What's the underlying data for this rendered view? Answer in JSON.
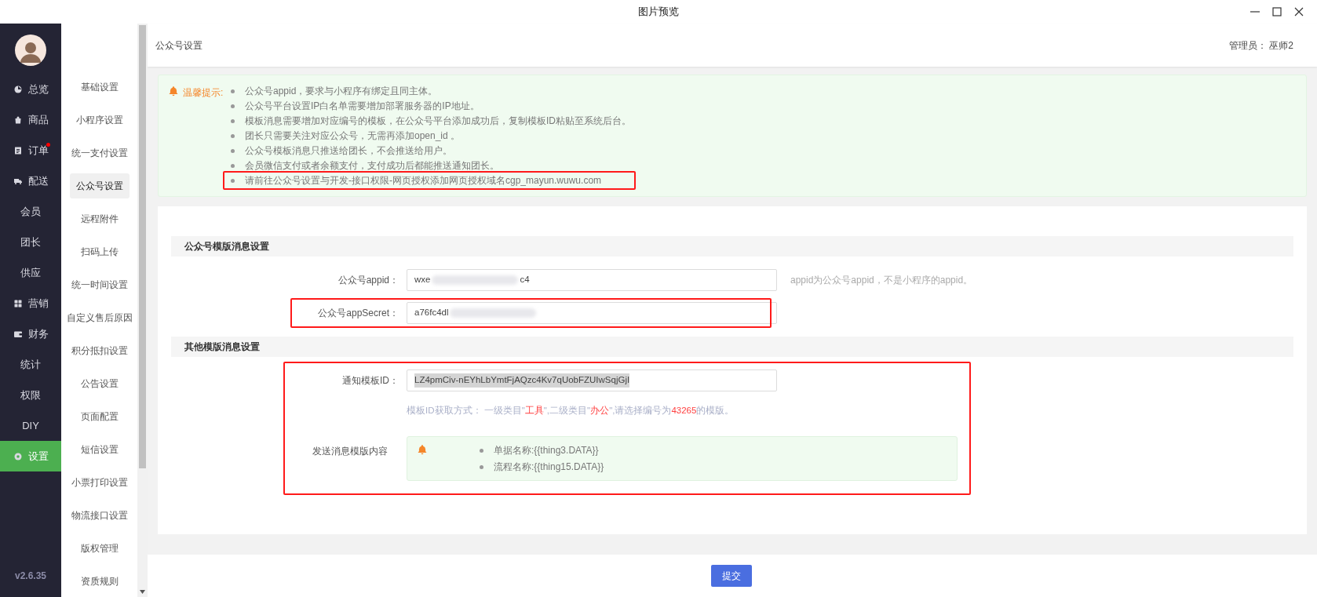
{
  "window": {
    "title": "图片预览"
  },
  "main_nav": {
    "version": "v2.6.35",
    "items": [
      {
        "label": "总览",
        "kind": "icon",
        "selected": false,
        "badge_dot": false
      },
      {
        "label": "商品",
        "kind": "icon",
        "selected": false,
        "badge_dot": false
      },
      {
        "label": "订单",
        "kind": "icon",
        "selected": false,
        "badge_dot": true
      },
      {
        "label": "配送",
        "kind": "icon",
        "selected": false,
        "badge_dot": false
      },
      {
        "label": "会员",
        "kind": "text",
        "selected": false,
        "badge_dot": false
      },
      {
        "label": "团长",
        "kind": "text",
        "selected": false,
        "badge_dot": false
      },
      {
        "label": "供应",
        "kind": "text",
        "selected": false,
        "badge_dot": false
      },
      {
        "label": "营销",
        "kind": "icon",
        "selected": false,
        "badge_dot": false
      },
      {
        "label": "财务",
        "kind": "icon",
        "selected": false,
        "badge_dot": false
      },
      {
        "label": "统计",
        "kind": "text",
        "selected": false,
        "badge_dot": false
      },
      {
        "label": "权限",
        "kind": "text",
        "selected": false,
        "badge_dot": false
      },
      {
        "label": "DIY",
        "kind": "text",
        "selected": false,
        "badge_dot": false
      },
      {
        "label": "设置",
        "kind": "icon",
        "selected": true,
        "badge_dot": false
      }
    ]
  },
  "sub_nav": {
    "items": [
      {
        "label": "基础设置",
        "selected": false
      },
      {
        "label": "小程序设置",
        "selected": false
      },
      {
        "label": "统一支付设置",
        "selected": false
      },
      {
        "label": "公众号设置",
        "selected": true
      },
      {
        "label": "远程附件",
        "selected": false
      },
      {
        "label": "扫码上传",
        "selected": false
      },
      {
        "label": "统一时间设置",
        "selected": false
      },
      {
        "label": "自定义售后原因",
        "selected": false
      },
      {
        "label": "积分抵扣设置",
        "selected": false
      },
      {
        "label": "公告设置",
        "selected": false
      },
      {
        "label": "页面配置",
        "selected": false
      },
      {
        "label": "短信设置",
        "selected": false
      },
      {
        "label": "小票打印设置",
        "selected": false
      },
      {
        "label": "物流接口设置",
        "selected": false
      },
      {
        "label": "版权管理",
        "selected": false
      },
      {
        "label": "资质规则",
        "selected": false
      }
    ]
  },
  "header": {
    "title": "公众号设置",
    "admin_label": "管理员：",
    "admin_name": "巫师2"
  },
  "tips": {
    "label": "温馨提示:",
    "items": [
      {
        "text": "公众号appid，要求与小程序有绑定且同主体。",
        "highlighted": false
      },
      {
        "text": "公众号平台设置IP白名单需要增加部署服务器的IP地址。",
        "highlighted": false
      },
      {
        "text": "模板消息需要增加对应编号的模板，在公众号平台添加成功后，复制模板ID粘贴至系统后台。",
        "highlighted": false
      },
      {
        "text": "团长只需要关注对应公众号，无需再添加open_id 。",
        "highlighted": false
      },
      {
        "text": "公众号模板消息只推送给团长，不会推送给用户。",
        "highlighted": false
      },
      {
        "text": "会员微信支付或者余额支付，支付成功后都能推送通知团长。",
        "highlighted": false
      },
      {
        "text": "请前往公众号设置与开发-接口权限-网页授权添加网页授权域名cgp_mayun.wuwu.com",
        "highlighted": true
      }
    ]
  },
  "sections": [
    {
      "title": "公众号模版消息设置",
      "fields": [
        {
          "kind": "input",
          "label": "公众号appid：",
          "value_start": "wxe",
          "value_end": "c4",
          "blurred": true,
          "help": "appid为公众号appid，不是小程序的appid。"
        },
        {
          "kind": "input",
          "label": "公众号appSecret：",
          "value_start": "a76fc4dl",
          "blurred": true,
          "highlighted": true
        }
      ]
    },
    {
      "title": "其他模版消息设置",
      "highlighted": true,
      "fields": [
        {
          "kind": "input",
          "label": "通知模板ID：",
          "value_start": "LZ4pmCiv-nEYhLbYmtFjAQzc4Kv7qUobFZUIwSqjGjI",
          "text_selected": true,
          "hint": [
            {
              "text": "模板ID获取方式：  一级类目\"",
              "emphasis": false
            },
            {
              "text": "工具",
              "emphasis": true
            },
            {
              "text": "\",二级类目\"",
              "emphasis": false
            },
            {
              "text": "办公",
              "emphasis": true
            },
            {
              "text": "\",请选择编号为",
              "emphasis": false
            },
            {
              "text": "43265",
              "emphasis": true
            },
            {
              "text": "的模版。",
              "emphasis": false
            }
          ]
        },
        {
          "kind": "notice",
          "label": "发送消息模版内容",
          "items": [
            "单据名称:{{thing3.DATA}}",
            "流程名称:{{thing15.DATA}}"
          ]
        }
      ]
    }
  ],
  "footer": {
    "submit": "提交"
  }
}
